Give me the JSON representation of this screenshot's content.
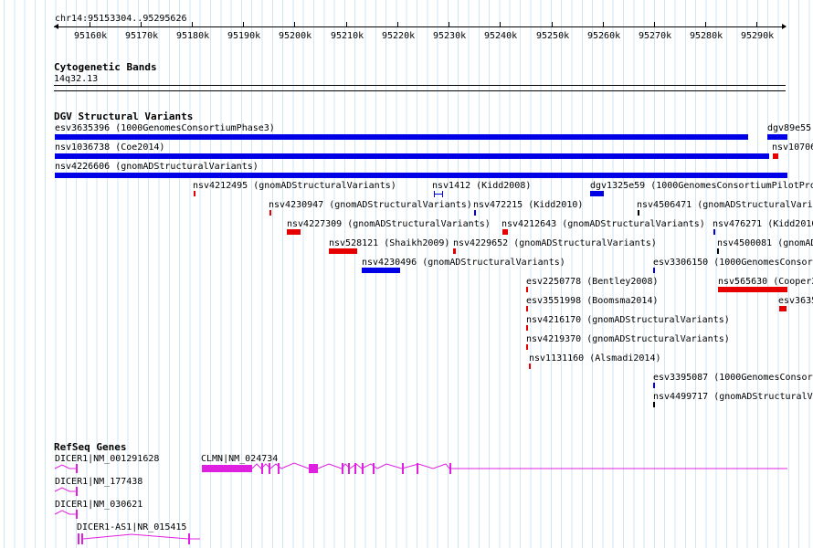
{
  "ruler": {
    "position": "chr14:95153304..95295626",
    "ticks": [
      "95160k",
      "95170k",
      "95180k",
      "95190k",
      "95200k",
      "95210k",
      "95220k",
      "95230k",
      "95240k",
      "95250k",
      "95260k",
      "95270k",
      "95280k",
      "95290k"
    ]
  },
  "cytoband": {
    "title": "Cytogenetic Bands",
    "band": "14q32.13"
  },
  "dgv": {
    "title": "DGV Structural Variants",
    "labels": {
      "l1": "esv3635396 (1000GenomesConsortiumPhase3)",
      "l2": "dgv89e55",
      "l3": "nsv1036738 (Coe2014)",
      "l4": "nsv10706",
      "l5": "nsv4226606 (gnomADStructuralVariants)",
      "l6": "nsv4212495 (gnomADStructuralVariants)",
      "l7": "nsv1412 (Kidd2008)",
      "l8": "dgv1325e59 (1000GenomesConsortiumPilotPro",
      "l9": "nsv4230947 (gnomADStructuralVariants)",
      "l10": "nsv472215 (Kidd2010)",
      "l11": "nsv4506471 (gnomADStructuralVari",
      "l12": "nsv4227309 (gnomADStructuralVariants)",
      "l13": "nsv4212643 (gnomADStructuralVariants)",
      "l14": "nsv476271 (Kidd2010",
      "l15": "nsv528121 (Shaikh2009)",
      "l16": "nsv4229652 (gnomADStructuralVariants)",
      "l17": "nsv4500081 (gnomAD",
      "l18": "nsv4230496 (gnomADStructuralVariants)",
      "l19": "esv3306150 (1000GenomesConsortium",
      "l20": "esv2250778 (Bentley2008)",
      "l21": "nsv565630 (Cooper2",
      "l22": "esv3551998 (Boomsma2014)",
      "l23": "esv3635",
      "l24": "nsv4216170 (gnomADStructuralVariants)",
      "l25": "nsv4219370 (gnomADStructuralVariants)",
      "l26": "nsv1131160 (Alsmadi2014)",
      "l27": "esv3395087 (1000GenomesConsortiu",
      "l28": "nsv4499717 (gnomADStructuralV"
    }
  },
  "refseq": {
    "title": "RefSeq Genes",
    "g1": "DICER1|NM_001291628",
    "g2": "CLMN|NM_024734",
    "g3": "DICER1|NM_177438",
    "g4": "DICER1|NM_030621",
    "g5": "DICER1-AS1|NR_015415"
  },
  "colors": {
    "loss": "#0000e6",
    "gain": "#e60000",
    "complex": "#000000",
    "gene": "#e020e0",
    "grid": "#cfe6f4"
  }
}
